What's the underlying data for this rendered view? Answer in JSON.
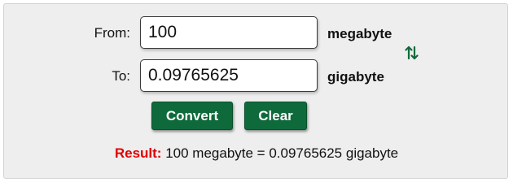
{
  "from": {
    "label": "From:",
    "value": "100",
    "unit": "megabyte"
  },
  "to": {
    "label": "To:",
    "value": "0.09765625",
    "unit": "gigabyte"
  },
  "swap": {
    "icon": "swap-arrows-icon",
    "color": "#0e6a3b"
  },
  "buttons": {
    "convert_label": "Convert",
    "clear_label": "Clear"
  },
  "result": {
    "label": "Result:",
    "text": "100 megabyte = 0.09765625 gigabyte"
  },
  "colors": {
    "button_bg": "#0e6a3b",
    "result_label": "#e10000",
    "panel_bg": "#eeeeee"
  }
}
